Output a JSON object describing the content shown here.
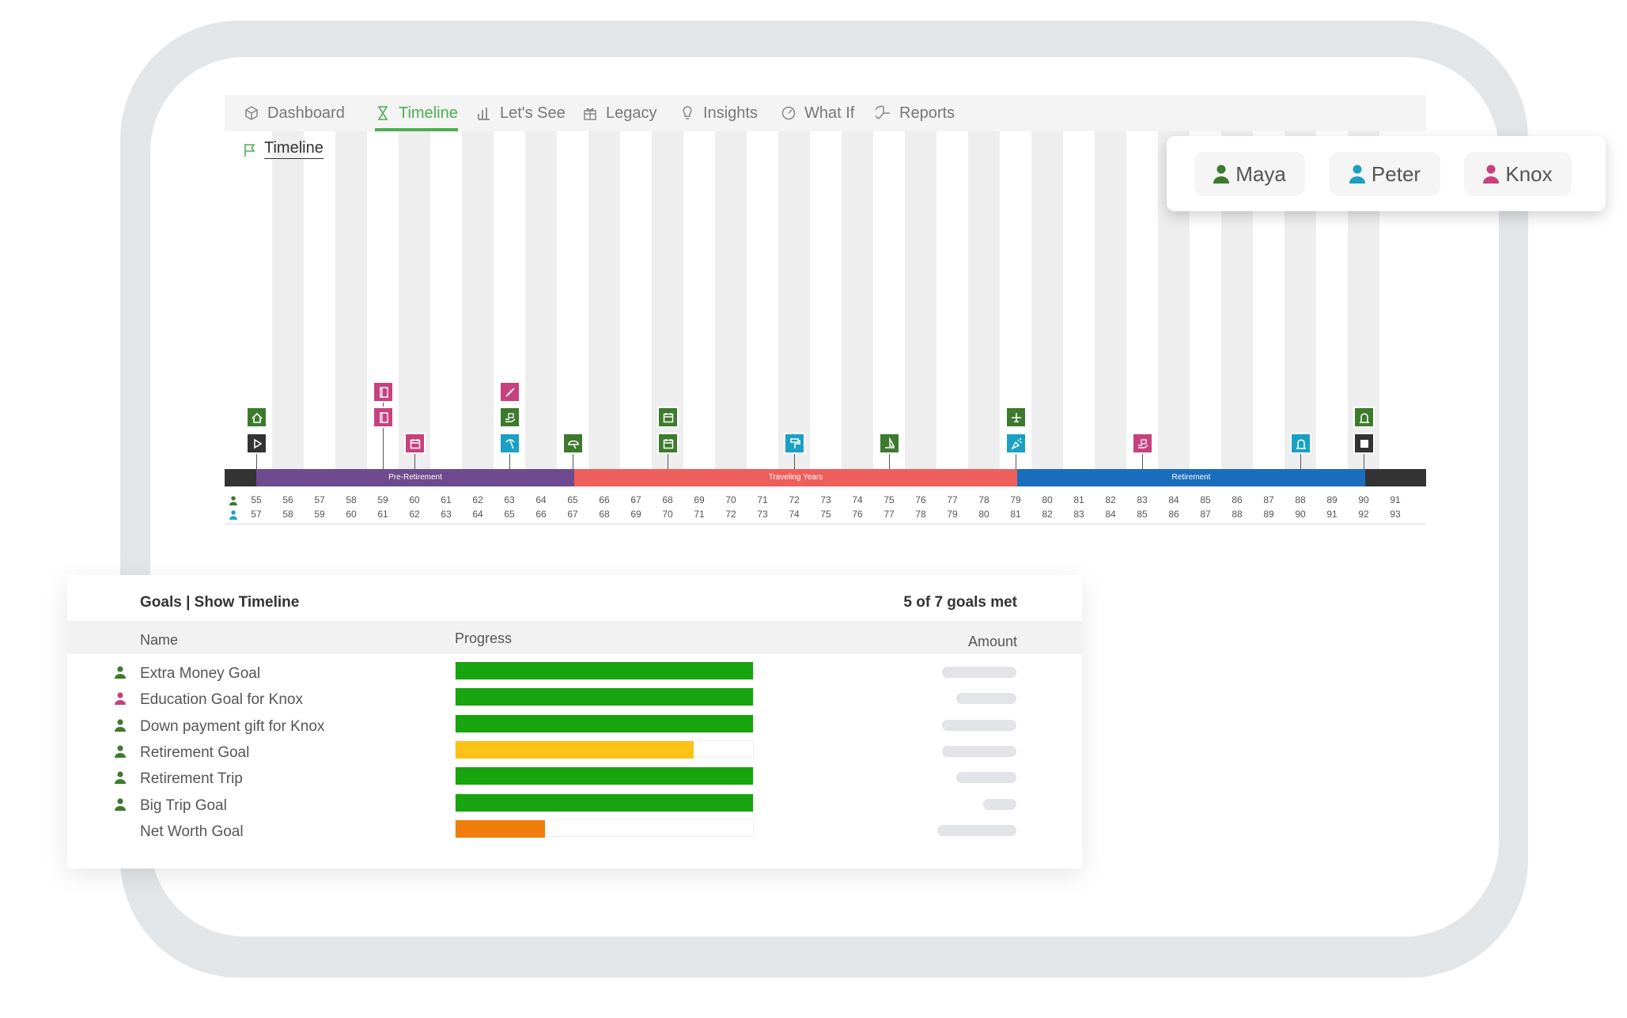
{
  "nav": {
    "tabs": [
      {
        "label": "Dashboard",
        "icon": "cube-icon",
        "active": false
      },
      {
        "label": "Timeline",
        "icon": "hourglass-icon",
        "active": true
      },
      {
        "label": "Let's See",
        "icon": "bar-chart-icon",
        "active": false
      },
      {
        "label": "Legacy",
        "icon": "gift-icon",
        "active": false
      },
      {
        "label": "Insights",
        "icon": "lightbulb-icon",
        "active": false
      },
      {
        "label": "What If",
        "icon": "gauge-icon",
        "active": false
      },
      {
        "label": "Reports",
        "icon": "pie-chart-icon",
        "active": false
      }
    ]
  },
  "timeline": {
    "title": "Timeline",
    "phases": [
      {
        "label": "",
        "color": "#333333"
      },
      {
        "label": "Pre-Retirement",
        "color": "#6f4a8e"
      },
      {
        "label": "Traveling Years",
        "color": "#ee5f5b"
      },
      {
        "label": "Retirement",
        "color": "#1a6dbd"
      },
      {
        "label": "",
        "color": "#333333"
      }
    ],
    "ages_person1": [
      "55",
      "56",
      "57",
      "58",
      "59",
      "60",
      "61",
      "62",
      "63",
      "64",
      "65",
      "66",
      "67",
      "68",
      "69",
      "70",
      "71",
      "72",
      "73",
      "74",
      "75",
      "76",
      "77",
      "78",
      "79",
      "80",
      "81",
      "82",
      "83",
      "84",
      "85",
      "86",
      "87",
      "88",
      "89",
      "90",
      "91"
    ],
    "ages_person2": [
      "57",
      "58",
      "59",
      "60",
      "61",
      "62",
      "63",
      "64",
      "65",
      "66",
      "67",
      "68",
      "69",
      "70",
      "71",
      "72",
      "73",
      "74",
      "75",
      "76",
      "77",
      "78",
      "79",
      "80",
      "81",
      "82",
      "83",
      "84",
      "85",
      "86",
      "87",
      "88",
      "89",
      "90",
      "91",
      "92",
      "93"
    ],
    "markers": [
      {
        "icon": "home-icon",
        "color": "#3d7a2e"
      },
      {
        "icon": "play-icon",
        "color": "#333333"
      },
      {
        "icon": "book-icon",
        "color": "#c7417e"
      },
      {
        "icon": "book-icon",
        "color": "#c7417e"
      },
      {
        "icon": "calendar-icon",
        "color": "#c7417e"
      },
      {
        "icon": "ruler-icon",
        "color": "#c7417e"
      },
      {
        "icon": "gift-hand-icon",
        "color": "#3d7a2e"
      },
      {
        "icon": "pickaxe-icon",
        "color": "#1ba0c4"
      },
      {
        "icon": "umbrella-icon",
        "color": "#3d7a2e"
      },
      {
        "icon": "calendar-icon",
        "color": "#3d7a2e"
      },
      {
        "icon": "calendar-icon",
        "color": "#3d7a2e"
      },
      {
        "icon": "paint-roller-icon",
        "color": "#1ba0c4"
      },
      {
        "icon": "sailboat-icon",
        "color": "#3d7a2e"
      },
      {
        "icon": "airplane-icon",
        "color": "#3d7a2e"
      },
      {
        "icon": "confetti-icon",
        "color": "#1ba0c4"
      },
      {
        "icon": "gift-hand-icon",
        "color": "#c7417e"
      },
      {
        "icon": "tombstone-icon",
        "color": "#1ba0c4"
      },
      {
        "icon": "tombstone-icon",
        "color": "#3d7a2e"
      },
      {
        "icon": "stop-icon",
        "color": "#333333"
      }
    ]
  },
  "people": [
    {
      "name": "Maya",
      "color": "#3d7a2e"
    },
    {
      "name": "Peter",
      "color": "#1ba0c4"
    },
    {
      "name": "Knox",
      "color": "#c7417e"
    }
  ],
  "goals": {
    "title": "Goals | Show Timeline",
    "summary": "5 of 7 goals met",
    "columns": {
      "name": "Name",
      "progress": "Progress",
      "amount": "Amount"
    },
    "rows": [
      {
        "name": "Extra Money Goal",
        "person_color": "#3d7a2e",
        "progress": 1.0,
        "bar_color": "#17a40f"
      },
      {
        "name": "Education Goal for Knox",
        "person_color": "#c7417e",
        "progress": 1.0,
        "bar_color": "#17a40f"
      },
      {
        "name": "Down payment gift for Knox",
        "person_color": "#3d7a2e",
        "progress": 1.0,
        "bar_color": "#17a40f"
      },
      {
        "name": "Retirement Goal",
        "person_color": "#3d7a2e",
        "progress": 0.8,
        "bar_color": "#fbc217"
      },
      {
        "name": "Retirement Trip",
        "person_color": "#3d7a2e",
        "progress": 1.0,
        "bar_color": "#17a40f"
      },
      {
        "name": "Big Trip Goal",
        "person_color": "#3d7a2e",
        "progress": 1.0,
        "bar_color": "#17a40f"
      },
      {
        "name": "Net Worth Goal",
        "person_color": "",
        "progress": 0.3,
        "bar_color": "#f07d0b"
      }
    ]
  }
}
